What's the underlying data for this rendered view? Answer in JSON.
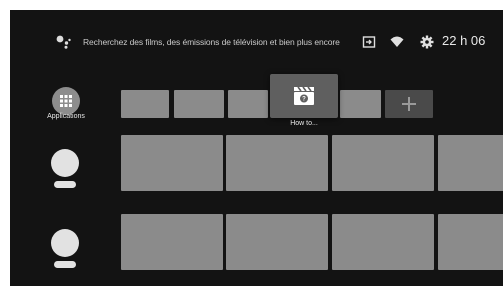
{
  "search": {
    "placeholder_text": "Recherchez des films, des émissions de télévision et bien plus encore"
  },
  "status": {
    "clock": "22 h 06"
  },
  "icons": {
    "assistant": "google-assistant-icon",
    "input": "input-source-icon",
    "wifi": "wifi-icon",
    "settings": "gear-icon",
    "apps": "grid-icon",
    "add": "plus-icon",
    "focused_app": "clapperboard-help-icon"
  },
  "apps_row": {
    "apps_label": "Applications",
    "focused_app_label": "How to..."
  },
  "colors": {
    "background": "#131313",
    "tile": "#8b8b8b",
    "focused_tile": "#5f5f5f",
    "add_tile": "#4a4a4a"
  }
}
